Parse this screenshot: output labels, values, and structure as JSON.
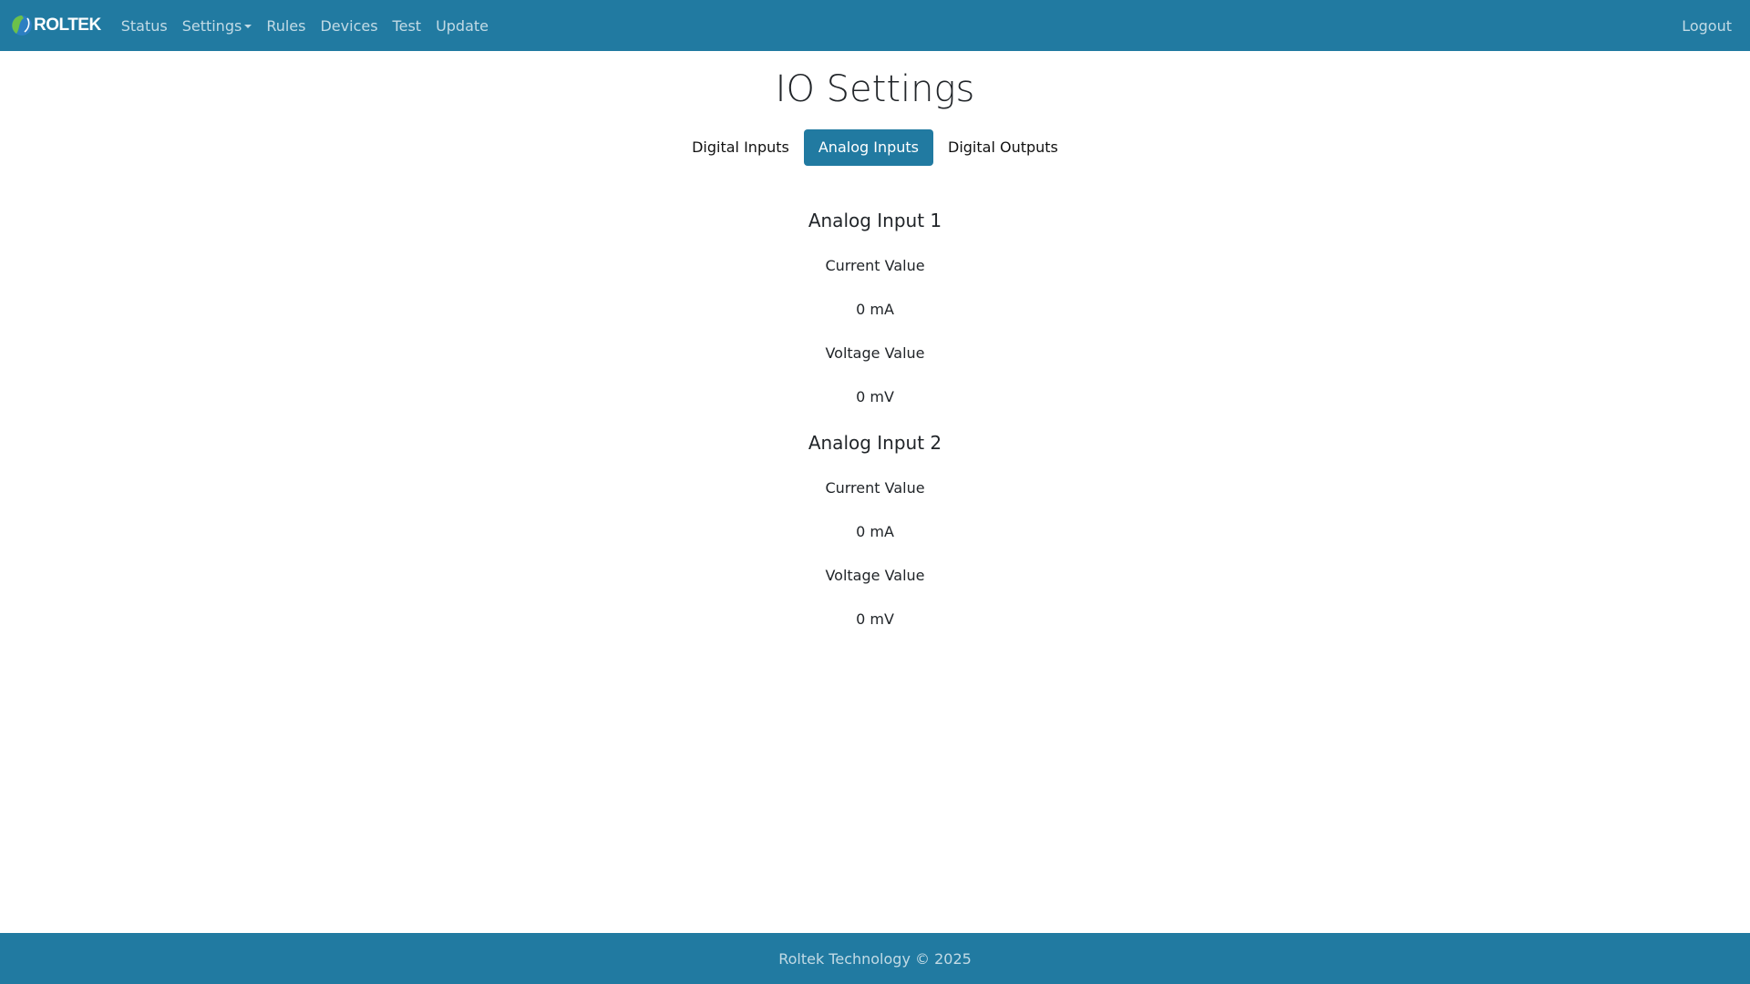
{
  "brand": {
    "name": "ROLTEK"
  },
  "nav": {
    "items": [
      {
        "label": "Status"
      },
      {
        "label": "Settings"
      },
      {
        "label": "Rules"
      },
      {
        "label": "Devices"
      },
      {
        "label": "Test"
      },
      {
        "label": "Update"
      }
    ],
    "logout_label": "Logout"
  },
  "page": {
    "title": "IO Settings",
    "tabs": [
      {
        "label": "Digital Inputs",
        "active": false
      },
      {
        "label": "Analog Inputs",
        "active": true
      },
      {
        "label": "Digital Outputs",
        "active": false
      }
    ]
  },
  "analog_inputs": [
    {
      "title": "Analog Input 1",
      "current_label": "Current Value",
      "current_value": "0 mA",
      "voltage_label": "Voltage Value",
      "voltage_value": "0 mV"
    },
    {
      "title": "Analog Input 2",
      "current_label": "Current Value",
      "current_value": "0 mA",
      "voltage_label": "Voltage Value",
      "voltage_value": "0 mV"
    }
  ],
  "footer": {
    "text": "Roltek Technology © 2025"
  },
  "colors": {
    "primary": "#217aa1",
    "logo_green": "#6cc04a",
    "logo_blue": "#2c7fc2"
  }
}
